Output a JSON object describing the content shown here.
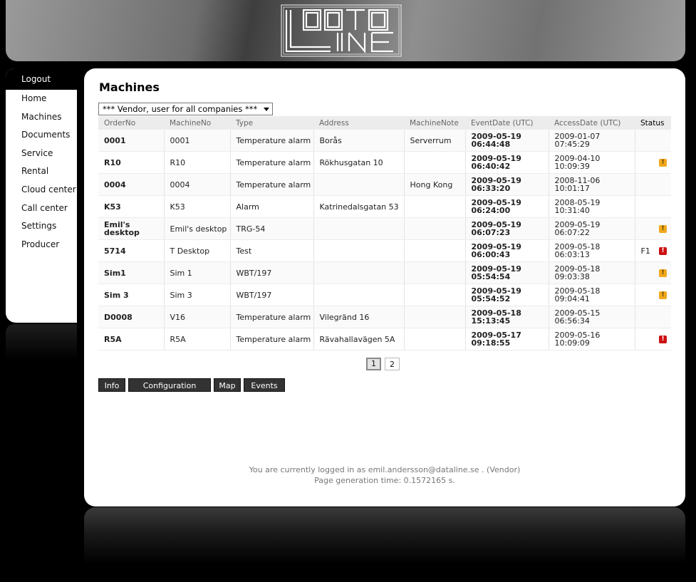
{
  "logo": {
    "text_top": "DATA",
    "text_bottom": "LINE"
  },
  "nav": {
    "items": [
      {
        "label": "Logout"
      },
      {
        "label": "Home"
      },
      {
        "label": "Machines"
      },
      {
        "label": "Documents"
      },
      {
        "label": "Service"
      },
      {
        "label": "Rental"
      },
      {
        "label": "Cloud center"
      },
      {
        "label": "Call center"
      },
      {
        "label": "Settings"
      },
      {
        "label": "Producer"
      }
    ]
  },
  "page": {
    "title": "Machines"
  },
  "filter": {
    "selected": "*** Vendor, user for all companies ***"
  },
  "table": {
    "columns": [
      "OrderNo",
      "MachineNo",
      "Type",
      "Address",
      "MachineNote",
      "EventDate (UTC)",
      "AccessDate (UTC)",
      "Status"
    ],
    "rows": [
      {
        "order": "0001",
        "machine": "0001",
        "type": "Temperature alarm",
        "address": "Borås",
        "note": "Serverrum",
        "event": "2009-05-19 06:44:48",
        "access": "2009-01-07 07:45:29",
        "status_text": "",
        "status_icon": "none"
      },
      {
        "order": "R10",
        "machine": "R10",
        "type": "Temperature alarm",
        "address": "Rökhusgatan 10",
        "note": "",
        "event": "2009-05-19 06:40:42",
        "access": "2009-04-10 10:09:39",
        "status_text": "",
        "status_icon": "warn"
      },
      {
        "order": "0004",
        "machine": "0004",
        "type": "Temperature alarm",
        "address": "",
        "note": "Hong Kong",
        "event": "2009-05-19 06:33:20",
        "access": "2008-11-06 10:01:17",
        "status_text": "",
        "status_icon": "none"
      },
      {
        "order": "K53",
        "machine": "K53",
        "type": "Alarm",
        "address": "Katrinedalsgatan 53",
        "note": "",
        "event": "2009-05-19 06:24:00",
        "access": "2008-05-19 10:31:40",
        "status_text": "",
        "status_icon": "none"
      },
      {
        "order": "Emil's desktop",
        "machine": "Emil's desktop",
        "type": "TRG-54",
        "address": "",
        "note": "",
        "event": "2009-05-19 06:07:23",
        "access": "2009-05-19 06:07:22",
        "status_text": "",
        "status_icon": "warn"
      },
      {
        "order": "5714",
        "machine": "T Desktop",
        "type": "Test",
        "address": "",
        "note": "",
        "event": "2009-05-19 06:00:43",
        "access": "2009-05-18 06:03:13",
        "status_text": "F1",
        "status_icon": "error"
      },
      {
        "order": "Sim1",
        "machine": "Sim 1",
        "type": "WBT/197",
        "address": "",
        "note": "",
        "event": "2009-05-19 05:54:54",
        "access": "2009-05-18 09:03:38",
        "status_text": "",
        "status_icon": "warn"
      },
      {
        "order": "Sim 3",
        "machine": "Sim 3",
        "type": "WBT/197",
        "address": "",
        "note": "",
        "event": "2009-05-19 05:54:52",
        "access": "2009-05-18 09:04:41",
        "status_text": "",
        "status_icon": "warn"
      },
      {
        "order": "D0008",
        "machine": "V16",
        "type": "Temperature alarm",
        "address": "Vilegränd 16",
        "note": "",
        "event": "2009-05-18 15:13:45",
        "access": "2009-05-15 06:56:34",
        "status_text": "",
        "status_icon": "none"
      },
      {
        "order": "R5A",
        "machine": "R5A",
        "type": "Temperature alarm",
        "address": "Rävahallavägen 5A",
        "note": "",
        "event": "2009-05-17 09:18:55",
        "access": "2009-05-16 10:09:09",
        "status_text": "",
        "status_icon": "error"
      }
    ]
  },
  "pagination": {
    "pages": [
      "1",
      "2"
    ],
    "current": "1"
  },
  "actions": {
    "info": "Info",
    "configuration": "Configuration",
    "map": "Map",
    "events": "Events"
  },
  "footer": {
    "logged_in": "You are currently logged in as emil.andersson@dataline.se . (Vendor)",
    "generation": "Page generation time: 0.1572165 s."
  },
  "colors": {
    "warn": "#f0a81c",
    "error": "#cc1111",
    "button": "#333333"
  },
  "icons": {
    "warn": "warning-icon",
    "error": "error-icon"
  }
}
